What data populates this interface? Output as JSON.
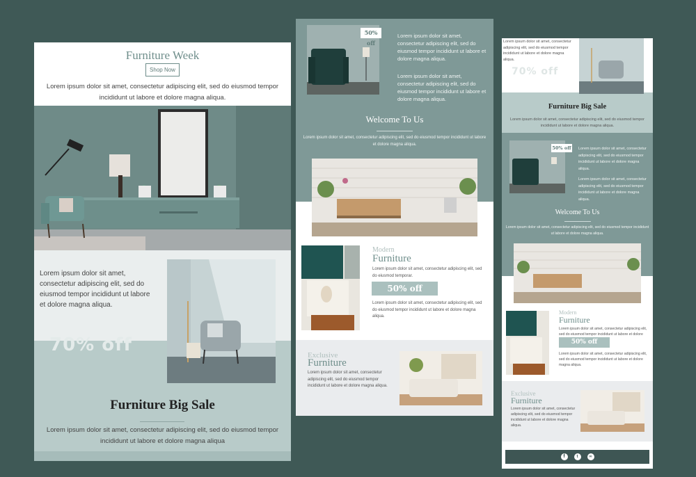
{
  "colors": {
    "background": "#3f5956",
    "teal": "#7f9997",
    "light_teal": "#b8cbc9",
    "sage": "#aac0be",
    "footer": "#3e5654"
  },
  "left": {
    "title": "Furniture Week",
    "button": "Shop Now",
    "intro": "Lorem ipsum dolor sit amet, consectetur adipiscing elit, sed do eiusmod tempor incididunt ut labore et dolore magna aliqua.",
    "feature_text": "Lorem ipsum dolor sit amet, consectetur adipiscing elit, sed do eiusmod tempor incididunt ut labore et dolore magna aliqua.",
    "discount": "70% off",
    "sale_title": "Furniture Big Sale",
    "sale_text": "Lorem ipsum dolor sit amet, consectetur adipiscing elit, sed do eiusmod tempor incididunt ut labore et dolore magna aliqua"
  },
  "middle": {
    "badge": "50% off",
    "para1": "Lorem ipsum dolor sit amet, consectetur adipiscing elit, sed do eiusmod tempor incididunt ut labore et dolore magna aliqua.",
    "para2": "Lorem ipsum dolor sit amet, consectetur adipiscing elit, sed do eiusmod tempor incididunt ut labore et dolore magna aliqua.",
    "welcome_title": "Welcome To Us",
    "welcome_text": "Lorem ipsum dolor sit amet, consectetur adipiscing elit, sed do eiusmod tempor incididunt ut labore et dolore magna aliqua.",
    "modern_label": "Modern",
    "modern_title": "Furniture",
    "modern_text": "Lorem ipsum dolor sit amet, consectetur adipiscing elit, sed do eiusmod temporar.",
    "modern_off": "50% off",
    "modern_text2": "Lorem ipsum dolor sit amet, consectetur adipiscing elit, sed do eiusmod tempor incididunt ut labore et dolore magna aliqua.",
    "exclusive_label": "Exclusive",
    "exclusive_title": "Furniture",
    "exclusive_text": "Lorem ipsum dolor sit amet, consectetur adipiscing elit, sed do eiusmod tempor incididunt ut labore et dolore magna aliqua."
  },
  "right": {
    "top_text": "Lorem ipsum dolor sit amet, consectetur adipiscing elit, sed do eiusmod tempor incididunt ut labore et dolore magna aliqua.",
    "discount": "70% off",
    "sale_title": "Furniture Big Sale",
    "sale_text": "Lorem ipsum dolor sit amet, consectetur adipiscing elit, sed do eiusmod tempor incididunt ut labore et dolore magna aliqua.",
    "badge": "50% off",
    "para1": "Lorem ipsum dolor sit amet, consectetur adipiscing elit, sed do eiusmod tempor incididunt ut labore et dolore magna aliqua.",
    "para2": "Lorem ipsum dolor sit amet, consectetur adipiscing elit, sed do eiusmod tempor incididunt ut labore et dolore magna aliqua.",
    "welcome_title": "Welcome To Us",
    "welcome_text": "Lorem ipsum dolor sit amet, consectetur adipiscing elit, sed do eiusmod tempor incididunt ut labore et dolore magna aliqua.",
    "modern_label": "Modern",
    "modern_title": "Furniture",
    "modern_text": "Lorem ipsum dolor sit amet, consectetur adipiscing elit, sed do eiusmod tempor incididunt ut labore et dolore magna aliqua.",
    "modern_off": "50% off",
    "modern_text2": "Lorem ipsum dolor sit amet, consectetur adipiscing elit, sed do eiusmod tempor incididunt ut labore et dolore magna aliqua.",
    "exclusive_label": "Exclusive",
    "exclusive_title": "Furniture",
    "exclusive_text": "Lorem ipsum dolor sit amet, consectetur adipiscing elit, sed do eiusmod tempor incididunt ut labore et dolore magna aliqua.",
    "social": [
      "facebook-icon",
      "twitter-icon",
      "link-icon"
    ]
  }
}
